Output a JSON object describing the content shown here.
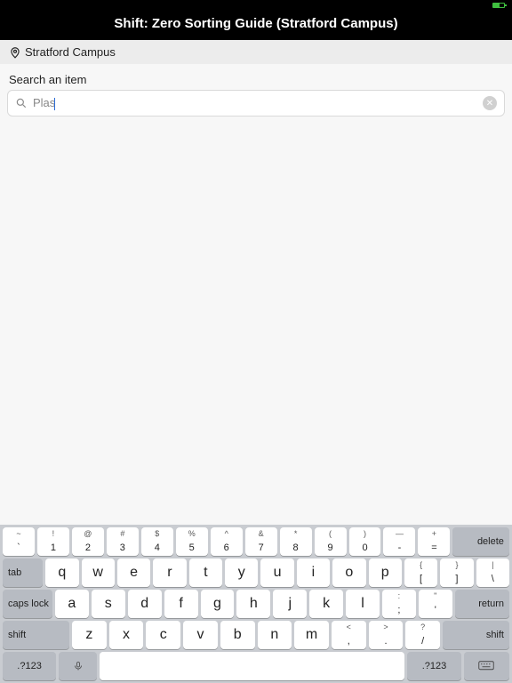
{
  "status": {
    "battery_color": "#3fbf3f"
  },
  "header": {
    "title": "Shift: Zero Sorting Guide (Stratford Campus)"
  },
  "location": {
    "name": "Stratford Campus"
  },
  "search": {
    "label": "Search an item",
    "value": "Plas",
    "clear_glyph": "✕"
  },
  "keyboard": {
    "row0": [
      {
        "top": "~",
        "bot": "`"
      },
      {
        "top": "!",
        "bot": "1"
      },
      {
        "top": "@",
        "bot": "2"
      },
      {
        "top": "#",
        "bot": "3"
      },
      {
        "top": "$",
        "bot": "4"
      },
      {
        "top": "%",
        "bot": "5"
      },
      {
        "top": "^",
        "bot": "6"
      },
      {
        "top": "&",
        "bot": "7"
      },
      {
        "top": "*",
        "bot": "8"
      },
      {
        "top": "(",
        "bot": "9"
      },
      {
        "top": ")",
        "bot": "0"
      },
      {
        "top": "—",
        "bot": "-"
      },
      {
        "top": "+",
        "bot": "="
      }
    ],
    "delete": "delete",
    "tab": "tab",
    "row1": [
      "q",
      "w",
      "e",
      "r",
      "t",
      "y",
      "u",
      "i",
      "o",
      "p"
    ],
    "row1_sym": [
      {
        "top": "{",
        "bot": "["
      },
      {
        "top": "}",
        "bot": "]"
      },
      {
        "top": "|",
        "bot": "\\"
      }
    ],
    "caps": "caps lock",
    "row2": [
      "a",
      "s",
      "d",
      "f",
      "g",
      "h",
      "j",
      "k",
      "l"
    ],
    "row2_sym": [
      {
        "top": ":",
        "bot": ";"
      },
      {
        "top": "\"",
        "bot": "'"
      }
    ],
    "return": "return",
    "shift": "shift",
    "row3": [
      "z",
      "x",
      "c",
      "v",
      "b",
      "n",
      "m"
    ],
    "row3_sym": [
      {
        "top": "<",
        "bot": ","
      },
      {
        "top": ">",
        "bot": "."
      },
      {
        "top": "?",
        "bot": "/"
      }
    ],
    "numtoggle": ".?123"
  }
}
